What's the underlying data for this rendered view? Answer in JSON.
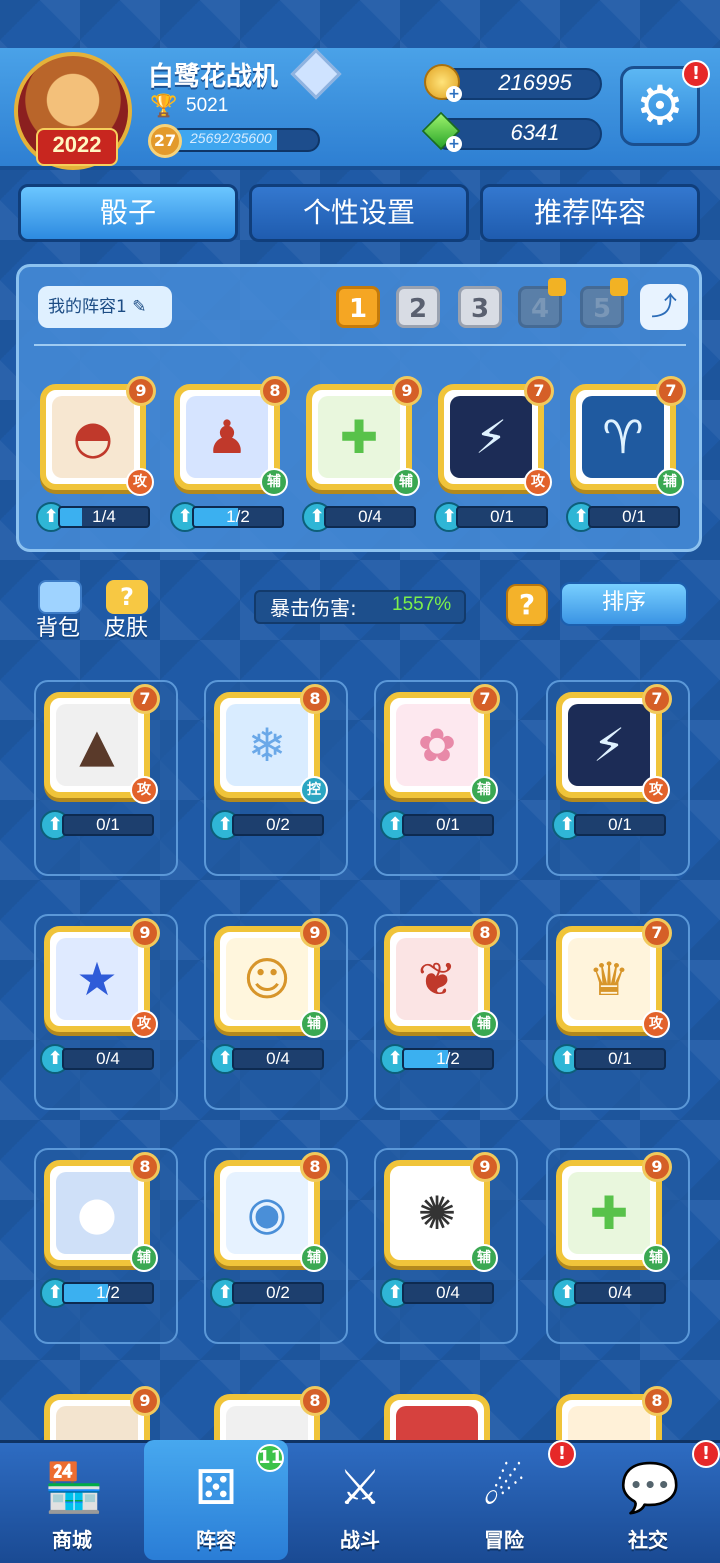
{
  "header": {
    "player_name": "白鹭花战机",
    "avatar_year": "2022",
    "trophies": "5021",
    "level": "27",
    "xp_text": "25692/35600",
    "xp_fraction": 0.72,
    "gold": "216995",
    "gems": "6341",
    "settings_alert": "!"
  },
  "tabs": [
    {
      "label": "骰子",
      "active": true
    },
    {
      "label": "个性设置",
      "active": false
    },
    {
      "label": "推荐阵容",
      "active": false
    }
  ],
  "deck": {
    "name": "我的阵容1",
    "slots": [
      "1",
      "2",
      "3",
      "4",
      "5"
    ],
    "active_slot": 0,
    "locked_slots": [
      3,
      4
    ],
    "cards": [
      {
        "level": "9",
        "type": "攻",
        "progress": "1/4",
        "fraction": 0.25,
        "icon": "hair-icon",
        "bg": "#f7e7d1",
        "glyph": "◓"
      },
      {
        "level": "8",
        "type": "辅",
        "progress": "1/2",
        "fraction": 0.5,
        "icon": "silhouette-icon",
        "bg": "#d6e4ff",
        "glyph": "♟"
      },
      {
        "level": "9",
        "type": "辅",
        "progress": "0/4",
        "fraction": 0,
        "icon": "heal-cross-icon",
        "bg": "#e9f7dd",
        "glyph": "✚"
      },
      {
        "level": "7",
        "type": "攻",
        "progress": "0/1",
        "fraction": 0,
        "icon": "thunder-hammer-icon",
        "bg": "#1c2c56",
        "glyph": "⚡"
      },
      {
        "level": "7",
        "type": "辅",
        "progress": "0/1",
        "fraction": 0,
        "icon": "ram-constellation-icon",
        "bg": "#1f5aa0",
        "glyph": "♈"
      }
    ]
  },
  "toolbar": {
    "backpack_label": "背包",
    "skin_label": "皮肤",
    "crit_label": "暴击伤害:",
    "crit_value": "1557%",
    "help_label": "?",
    "sort_label": "排序"
  },
  "collection": [
    {
      "level": "7",
      "type": "攻",
      "progress": "0/1",
      "fraction": 0,
      "icon": "volcano-icon",
      "bg": "#f0f0f0",
      "glyph": "▲"
    },
    {
      "level": "8",
      "type": "控",
      "progress": "0/2",
      "fraction": 0,
      "icon": "ice-wings-icon",
      "bg": "#d9ecff",
      "glyph": "❄"
    },
    {
      "level": "7",
      "type": "辅",
      "progress": "0/1",
      "fraction": 0,
      "icon": "sakura-icon",
      "bg": "#fde8ef",
      "glyph": "✿"
    },
    {
      "level": "7",
      "type": "攻",
      "progress": "0/1",
      "fraction": 0,
      "icon": "thunder-hammer-icon",
      "bg": "#1c2c56",
      "glyph": "⚡"
    },
    {
      "level": "9",
      "type": "攻",
      "progress": "0/4",
      "fraction": 0,
      "icon": "star-icon",
      "bg": "#dfeaff",
      "glyph": "★"
    },
    {
      "level": "9",
      "type": "辅",
      "progress": "0/4",
      "fraction": 0,
      "icon": "lucky-cat-icon",
      "bg": "#fff6dd",
      "glyph": "☺"
    },
    {
      "level": "8",
      "type": "辅",
      "progress": "1/2",
      "fraction": 0.5,
      "icon": "paw-icon",
      "bg": "#fbe4e4",
      "glyph": "❦"
    },
    {
      "level": "7",
      "type": "攻",
      "progress": "0/1",
      "fraction": 0,
      "icon": "golden-crown-icon",
      "bg": "#fff4dc",
      "glyph": "♛"
    },
    {
      "level": "8",
      "type": "辅",
      "progress": "1/2",
      "fraction": 0.5,
      "icon": "moon-icon",
      "bg": "#cfe0f8",
      "glyph": "●"
    },
    {
      "level": "8",
      "type": "辅",
      "progress": "0/2",
      "fraction": 0,
      "icon": "signal-icon",
      "bg": "#e6f2ff",
      "glyph": "◉"
    },
    {
      "level": "9",
      "type": "辅",
      "progress": "0/4",
      "fraction": 0,
      "icon": "thorn-web-icon",
      "bg": "#ffffff",
      "glyph": "✺"
    },
    {
      "level": "9",
      "type": "辅",
      "progress": "0/4",
      "fraction": 0,
      "icon": "heal-cross-icon",
      "bg": "#e9f7dd",
      "glyph": "✚"
    },
    {
      "level": "9",
      "type": "",
      "progress": "",
      "fraction": 0,
      "icon": "partial-card-icon",
      "bg": "#f3e4cf",
      "glyph": ""
    },
    {
      "level": "8",
      "type": "",
      "progress": "",
      "fraction": 0,
      "icon": "partial-card-icon",
      "bg": "#f0f0f0",
      "glyph": ""
    },
    {
      "level": "",
      "type": "",
      "progress": "",
      "fraction": 0,
      "icon": "partial-card-icon",
      "bg": "#d6413e",
      "glyph": ""
    },
    {
      "level": "8",
      "type": "",
      "progress": "",
      "fraction": 0,
      "icon": "sun-icon",
      "bg": "#fff1d8",
      "glyph": ""
    }
  ],
  "nav": [
    {
      "label": "商城",
      "icon": "shop-icon",
      "glyph": "🏪",
      "badge": "",
      "active": false
    },
    {
      "label": "阵容",
      "icon": "dice-icon",
      "glyph": "⚄",
      "badge": "11",
      "active": true
    },
    {
      "label": "战斗",
      "icon": "crossed-swords-icon",
      "glyph": "⚔",
      "badge": "",
      "active": false
    },
    {
      "label": "冒险",
      "icon": "planet-icon",
      "glyph": "☄",
      "badge": "!",
      "active": false
    },
    {
      "label": "社交",
      "icon": "chat-icon",
      "glyph": "💬",
      "badge": "!",
      "active": false
    }
  ]
}
